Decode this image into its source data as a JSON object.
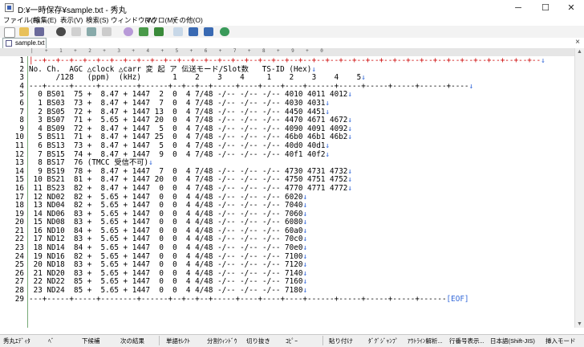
{
  "window": {
    "title": "D:¥一時保存¥sample.txt - 秀丸",
    "minimize": "─",
    "maximize": "☐",
    "close": "✕"
  },
  "menu": [
    "ファイル(F)",
    "編集(E)",
    "表示(V)",
    "検索(S)",
    "ウィンドウ(W)",
    "マクロ(M)",
    "その他(O)"
  ],
  "tab": {
    "label": "sample.txt",
    "close": "×"
  },
  "ruler": "|    +    1    +    2    +    3    +    4    +    5    +    6    +    7    +    8    +    9    +    0",
  "editor": {
    "eol_mark": "↓",
    "eof_mark": "[EOF]",
    "lines": [
      {
        "n": "1",
        "text": "|--+--+--+--+--+--+--+--+--+--+--+--+--+--+--+--+--+--+--+--+--+--+--+--+--+--+--+--+--+--+--+--+--+--+--+--+--+--",
        "eol": true
      },
      {
        "n": "2",
        "text": "No. Ch.  AGC △clock △carr 変 起 ア 伝送モード/Slot数   TS-ID (Hex)",
        "eol": true
      },
      {
        "n": "3",
        "text": "      /128   (ppm)  (kHz)       1    2    3    4     1    2    3    4    5",
        "eol": true
      },
      {
        "n": "4",
        "text": "---+-----+-----+--------+------+--+--+--+-----+----+----+----+------+-----+-----+-----+------+----",
        "eol": true
      },
      {
        "n": "5",
        "text": "  0 BS01  75 +  8.47 + 1447  2  0  4 7/48 -/-- -/-- -/-- 4010 4011 4012",
        "eol": true
      },
      {
        "n": "6",
        "text": "  1 BS03  73 +  8.47 + 1447  7  0  4 7/48 -/-- -/-- -/-- 4030 4031",
        "eol": true
      },
      {
        "n": "7",
        "text": "  2 BS05  72 +  8.47 + 1447 13  0  4 7/48 -/-- -/-- -/-- 4450 4451",
        "eol": true
      },
      {
        "n": "8",
        "text": "  3 BS07  71 +  5.65 + 1447 20  0  4 7/48 -/-- -/-- -/-- 4470 4671 4672",
        "eol": true
      },
      {
        "n": "9",
        "text": "  4 BS09  72 +  8.47 + 1447  5  0  4 7/48 -/-- -/-- -/-- 4090 4091 4092",
        "eol": true
      },
      {
        "n": "10",
        "text": "  5 BS11  71 +  8.47 + 1447 25  0  4 7/48 -/-- -/-- -/-- 46b0 46b1 46b2",
        "eol": true
      },
      {
        "n": "11",
        "text": "  6 BS13  73 +  8.47 + 1447  5  0  4 7/48 -/-- -/-- -/-- 40d0 40d1",
        "eol": true
      },
      {
        "n": "12",
        "text": "  7 BS15  74 +  8.47 + 1447  9  0  4 7/48 -/-- -/-- -/-- 40f1 40f2",
        "eol": true
      },
      {
        "n": "13",
        "text": "  8 BS17  76 (TMCC 受信不可)",
        "eol": true
      },
      {
        "n": "14",
        "text": "  9 BS19  78 +  8.47 + 1447  7  0  4 7/48 -/-- -/-- -/-- 4730 4731 4732",
        "eol": true
      },
      {
        "n": "15",
        "text": " 10 BS21  81 +  8.47 + 1447 20  0  4 7/48 -/-- -/-- -/-- 4750 4751 4752",
        "eol": true
      },
      {
        "n": "16",
        "text": " 11 BS23  82 +  8.47 + 1447  0  0  4 7/48 -/-- -/-- -/-- 4770 4771 4772",
        "eol": true
      },
      {
        "n": "17",
        "text": " 12 ND02  82 +  5.65 + 1447  0  0  4 4/48 -/-- -/-- -/-- 6020",
        "eol": true
      },
      {
        "n": "18",
        "text": " 13 ND04  82 +  5.65 + 1447  0  0  4 4/48 -/-- -/-- -/-- 7040",
        "eol": true
      },
      {
        "n": "19",
        "text": " 14 ND06  83 +  5.65 + 1447  0  0  4 4/48 -/-- -/-- -/-- 7060",
        "eol": true
      },
      {
        "n": "20",
        "text": " 15 ND08  83 +  5.65 + 1447  0  0  4 4/48 -/-- -/-- -/-- 6080",
        "eol": true
      },
      {
        "n": "21",
        "text": " 16 ND10  84 +  5.65 + 1447  0  0  4 4/48 -/-- -/-- -/-- 60a0",
        "eol": true
      },
      {
        "n": "22",
        "text": " 17 ND12  83 +  5.65 + 1447  0  0  4 4/48 -/-- -/-- -/-- 70c0",
        "eol": true
      },
      {
        "n": "23",
        "text": " 18 ND14  84 +  5.65 + 1447  0  0  4 4/48 -/-- -/-- -/-- 70e0",
        "eol": true
      },
      {
        "n": "24",
        "text": " 19 ND16  82 +  5.65 + 1447  0  0  4 4/48 -/-- -/-- -/-- 7100",
        "eol": true
      },
      {
        "n": "25",
        "text": " 20 ND18  83 +  5.65 + 1447  0  0  4 4/48 -/-- -/-- -/-- 7120",
        "eol": true
      },
      {
        "n": "26",
        "text": " 21 ND20  83 +  5.65 + 1447  0  0  4 4/48 -/-- -/-- -/-- 7140",
        "eol": true
      },
      {
        "n": "27",
        "text": " 22 ND22  85 +  5.65 + 1447  0  0  4 4/48 -/-- -/-- -/-- 7160",
        "eol": true
      },
      {
        "n": "28",
        "text": " 23 ND24  85 +  5.65 + 1447  0  0  4 4/48 -/-- -/-- -/-- 7180",
        "eol": true
      },
      {
        "n": "29",
        "text": "---+-----+-----+--------+------+--+--+--+-----+----+----+----+------+-----+-----+-----+------",
        "eol": false,
        "eof": true
      }
    ]
  },
  "status": {
    "s1": "秀丸ｴﾃﾞｨﾀ",
    "s2": "ﾍﾞ",
    "s3": "下候補",
    "s4": "次の結果",
    "s5": "単語ｾﾚｸﾄ",
    "s6": "分割ｳｨﾝﾄﾞｳ",
    "s7": "切り抜き",
    "s8": "ｺﾋﾟｰ",
    "s9": "貼り付け",
    "s10": "ﾀﾞｸﾞｼﾞｬﾝﾌﾟ",
    "s11": "ｱｳﾄﾗｲﾝ解析...",
    "s12": "行番号表示...",
    "s13": "日本語(Shift-JIS)",
    "s14": "挿入モード"
  }
}
